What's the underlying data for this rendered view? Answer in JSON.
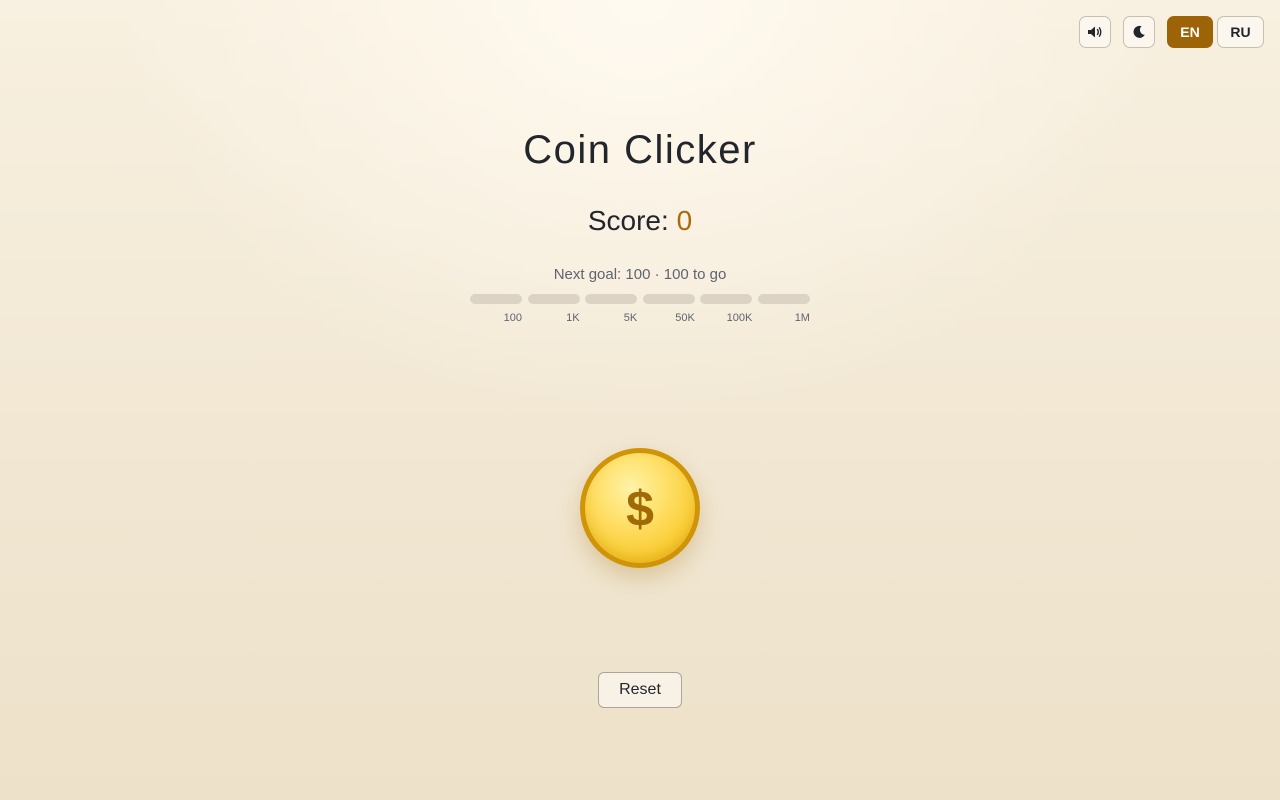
{
  "controls": {
    "sound_icon": "speaker-icon",
    "theme_icon": "moon-icon",
    "languages": [
      {
        "label": "EN",
        "active": true
      },
      {
        "label": "RU",
        "active": false
      }
    ]
  },
  "game": {
    "title": "Coin Clicker",
    "score_label": "Score:",
    "score_value": "0",
    "next_goal": "Next goal: 100 · 100 to go",
    "milestones": [
      {
        "label": "100",
        "progress": 0
      },
      {
        "label": "1K",
        "progress": 0
      },
      {
        "label": "5K",
        "progress": 0
      },
      {
        "label": "50K",
        "progress": 0
      },
      {
        "label": "100K",
        "progress": 0
      },
      {
        "label": "1M",
        "progress": 0
      }
    ],
    "coin_symbol": "$",
    "reset_label": "Reset"
  },
  "colors": {
    "accent": "#9c6307",
    "score_value": "#a86c0c",
    "coin_gold": "#f9cc33",
    "coin_rim": "#cf9408",
    "milestone_track": "#dcd3c5"
  }
}
